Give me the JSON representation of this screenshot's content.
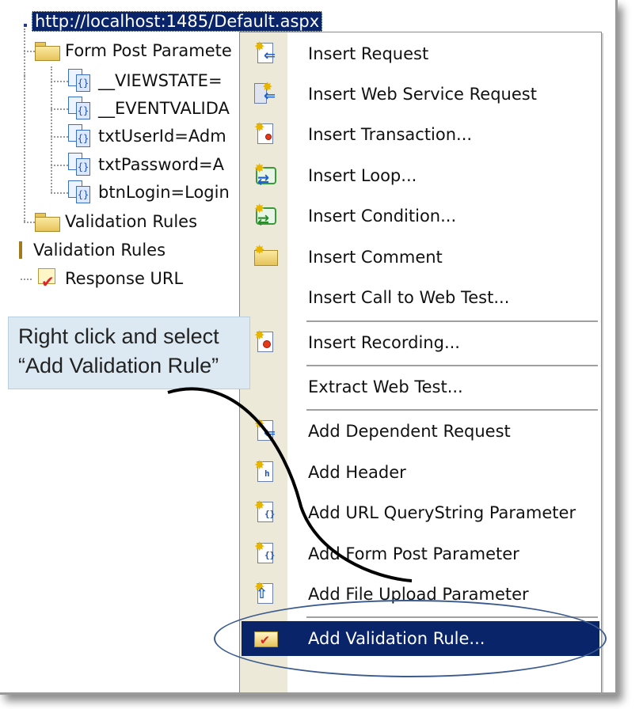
{
  "tree": {
    "url": "http://localhost:1485/Default.aspx",
    "form_post_folder": "Form Post Paramete",
    "params": [
      "__VIEWSTATE=",
      "__EVENTVALIDA",
      "txtUserId=Adm",
      "txtPassword=A",
      "btnLogin=Login"
    ],
    "validation_rules_folder": "Validation Rules",
    "validation_rules_root": "Validation Rules",
    "response_url": "Response URL"
  },
  "menu": {
    "items": [
      {
        "label": "Insert Request",
        "icon": "insert-request-icon"
      },
      {
        "label": "Insert Web Service Request",
        "icon": "web-service-icon"
      },
      {
        "label": "Insert Transaction...",
        "icon": "transaction-icon"
      },
      {
        "label": "Insert Loop...",
        "icon": "loop-icon"
      },
      {
        "label": "Insert Condition...",
        "icon": "condition-icon"
      },
      {
        "label": "Insert Comment",
        "icon": "comment-icon"
      },
      {
        "label": "Insert Call to Web Test...",
        "icon": ""
      },
      {
        "label": "Insert Recording...",
        "icon": "recording-icon"
      },
      {
        "label": "Extract Web Test...",
        "icon": ""
      },
      {
        "label": "Add Dependent Request",
        "icon": "dependent-request-icon"
      },
      {
        "label": "Add Header",
        "icon": "header-icon"
      },
      {
        "label": "Add URL QueryString Parameter",
        "icon": "querystring-icon"
      },
      {
        "label": "Add Form Post Parameter",
        "icon": "form-post-icon"
      },
      {
        "label": "Add File Upload Parameter",
        "icon": "file-upload-icon"
      },
      {
        "label": "Add Validation Rule...",
        "icon": "validation-rule-icon",
        "selected": true
      }
    ]
  },
  "callout": {
    "line1": "Right click and select",
    "line2": "“Add Validation Rule”"
  },
  "colors": {
    "selection": "#0a246a",
    "callout_bg": "#dce9f3",
    "ring": "#3b5b8f"
  }
}
